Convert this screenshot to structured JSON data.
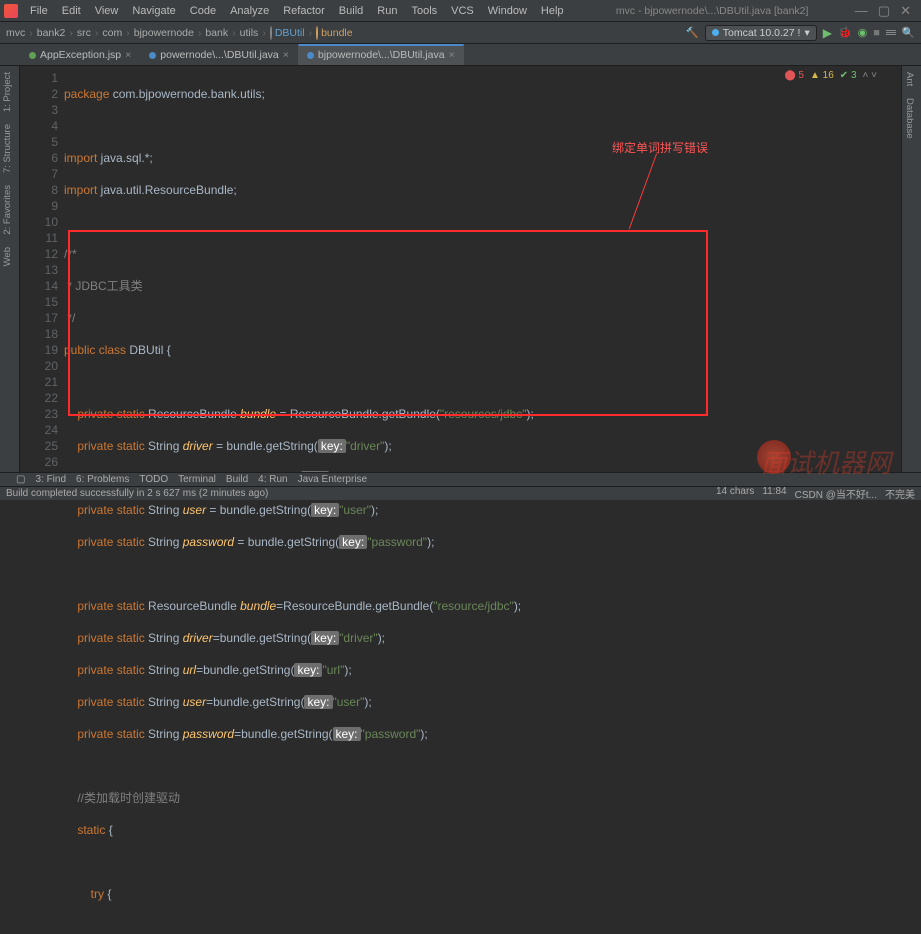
{
  "title": "mvc - bjpowernode\\...\\DBUtil.java [bank2]",
  "menu": [
    "File",
    "Edit",
    "View",
    "Navigate",
    "Code",
    "Analyze",
    "Refactor",
    "Build",
    "Run",
    "Tools",
    "VCS",
    "Window",
    "Help"
  ],
  "breadcrumbs": [
    "mvc",
    "bank2",
    "src",
    "com",
    "bjpowernode",
    "bank",
    "utils",
    "DBUtil",
    "bundle"
  ],
  "run_config": "Tomcat 10.0.27 !",
  "tabs": [
    {
      "label": "AppException.jsp",
      "active": false
    },
    {
      "label": "powernode\\...\\DBUtil.java",
      "active": false
    },
    {
      "label": "bjpowernode\\...\\DBUtil.java",
      "active": true
    }
  ],
  "inspection": {
    "errors": "5",
    "warnings": "16",
    "ok": "3"
  },
  "lines": [
    1,
    2,
    3,
    4,
    5,
    6,
    7,
    8,
    9,
    10,
    11,
    12,
    13,
    14,
    15,
    17,
    18,
    19,
    20,
    21,
    22,
    23,
    24,
    25,
    26
  ],
  "annotation": "绑定单词拼写错误",
  "side_left": [
    "1: Project",
    "7: Structure",
    "2: Favorites",
    "Web"
  ],
  "side_right": [
    "Ant",
    "Database"
  ],
  "bottom_tabs": [
    "3: Find",
    "6: Problems",
    "TODO",
    "Terminal",
    "Build",
    "4: Run",
    "Java Enterprise"
  ],
  "status_left": "Build completed successfully in 2 s 627 ms (2 minutes ago)",
  "status_right": [
    "14 chars",
    "11:84",
    "CSDN @当不好t...",
    "不完美"
  ],
  "code": {
    "l1": {
      "kw": "package",
      "pkg": " com.bjpowernode.bank.utils;"
    },
    "l3": {
      "kw": "import",
      "pkg": " java.sql.*;"
    },
    "l4": {
      "kw": "import",
      "pkg": " java.util.ResourceBundle;"
    },
    "l6": "/**",
    "l7": " * JDBC工具类",
    "l8": " */",
    "l9": {
      "kw1": "public class",
      "cls": " DBUtil",
      "b": " {"
    },
    "l11": {
      "pre": "    ",
      "kw": "private static",
      "typ": " ResourceBundle",
      "id": " bundle",
      "eq": " = ResourceBundle.getBundle(",
      "str": "\"resources/jdbc\"",
      "end": ");"
    },
    "l12": {
      "pre": "    ",
      "kw": "private static",
      "typ": " String",
      "id": " driver",
      "eq": " = bundle.getString(",
      "pill": "key:",
      "str": "\"driver\"",
      "end": ");"
    },
    "l13": {
      "pre": "    ",
      "kw": "private static",
      "typ": " String",
      "id": " url",
      "eq": " = bundle.getString(",
      "pill": "key:",
      "str": "\"url\"",
      "end": ");"
    },
    "l14": {
      "pre": "    ",
      "kw": "private static",
      "typ": " String",
      "id": " user",
      "eq": " = bundle.getString(",
      "pill": "key:",
      "str": "\"user\"",
      "end": ");"
    },
    "l15": {
      "pre": "    ",
      "kw": "private static",
      "typ": " String",
      "id": " password",
      "eq": " = bundle.getString(",
      "pill": "key:",
      "str": "\"password\"",
      "end": ");"
    },
    "l17": {
      "pre": "    ",
      "kw": "private static",
      "typ": " ResourceBundle",
      "id": " bundle",
      "eq": "=ResourceBundle.getBundle(",
      "str": "\"resource/jdbc\"",
      "end": ");"
    },
    "l18": {
      "pre": "    ",
      "kw": "private static",
      "typ": " String",
      "id": " driver",
      "eq": "=bundle.getString(",
      "pill": "key:",
      "str": "\"driver\"",
      "end": ");"
    },
    "l19": {
      "pre": "    ",
      "kw": "private static",
      "typ": " String",
      "id": " url",
      "eq": "=bundle.getString(",
      "pill": "key:",
      "str": "\"url\"",
      "end": ");"
    },
    "l20": {
      "pre": "    ",
      "kw": "private static",
      "typ": " String",
      "id": " user",
      "eq": "=bundle.getString(",
      "pill": "key:",
      "str": "\"user\"",
      "end": ");"
    },
    "l21": {
      "pre": "    ",
      "kw": "private static",
      "typ": " String",
      "id": " password",
      "eq": "=bundle.getString(",
      "pill": "key:",
      "str": "\"password\"",
      "end": ");"
    },
    "l23": "    //类加载时创建驱动",
    "l24": {
      "pre": "    ",
      "kw": "static",
      "b": " {"
    },
    "l26": {
      "pre": "        ",
      "kw": "try",
      "b": " {"
    }
  }
}
